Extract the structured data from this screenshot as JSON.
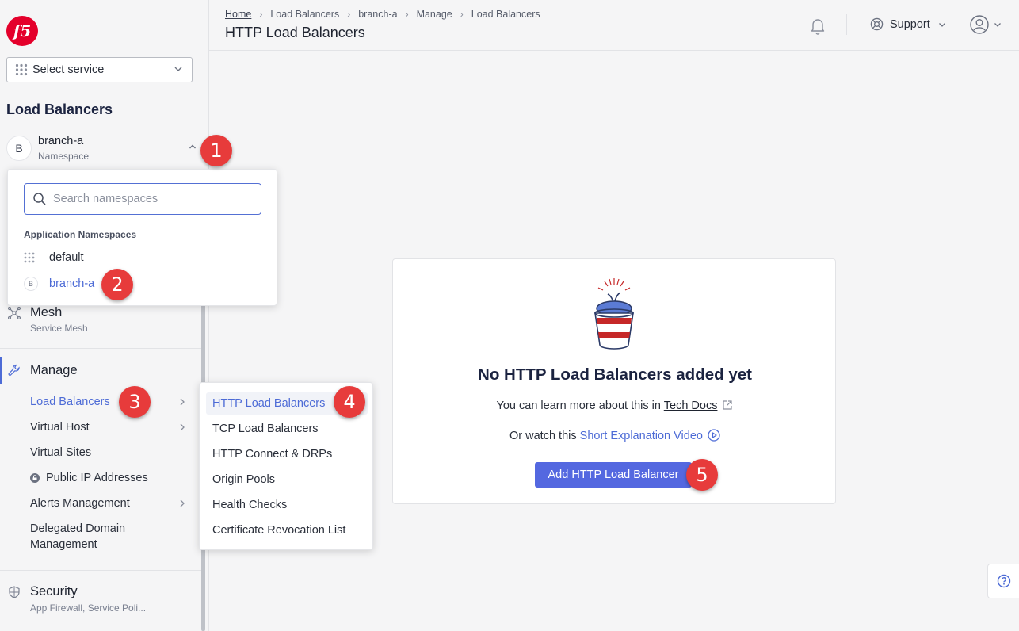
{
  "header": {
    "breadcrumb": [
      "Home",
      "Load Balancers",
      "branch-a",
      "Manage",
      "Load Balancers"
    ],
    "title": "HTTP Load Balancers",
    "support_label": "Support"
  },
  "sidebar": {
    "select_service": "Select service",
    "section_title": "Load Balancers",
    "namespace": {
      "avatar": "B",
      "name": "branch-a",
      "sub": "Namespace"
    },
    "mesh": {
      "title": "Mesh",
      "sub": "Service Mesh"
    },
    "manage": {
      "title": "Manage",
      "items": [
        "Load Balancers",
        "Virtual Host",
        "Virtual Sites",
        "Public IP Addresses",
        "Alerts Management",
        "Delegated Domain",
        "Management"
      ]
    },
    "security": {
      "title": "Security",
      "sub": "App Firewall, Service Poli..."
    }
  },
  "namespace_dropdown": {
    "search_placeholder": "Search namespaces",
    "group_label": "Application Namespaces",
    "options": [
      {
        "label": "default",
        "avatar": ""
      },
      {
        "label": "branch-a",
        "avatar": "B"
      }
    ]
  },
  "lb_menu": {
    "items": [
      "HTTP Load Balancers",
      "TCP Load Balancers",
      "HTTP Connect & DRPs",
      "Origin Pools",
      "Health Checks",
      "Certificate Revocation List"
    ]
  },
  "empty_state": {
    "title": "No HTTP Load Balancers added yet",
    "line1_prefix": "You can learn more about this in",
    "line1_link": "Tech Docs",
    "line2_prefix": "Or watch this",
    "line2_link": "Short Explanation Video",
    "button": "Add HTTP Load Balancer"
  },
  "badges": [
    "1",
    "2",
    "3",
    "4",
    "5"
  ],
  "colors": {
    "accent": "#5468e0",
    "badge": "#e73b3b",
    "brand": "#e4002b"
  }
}
